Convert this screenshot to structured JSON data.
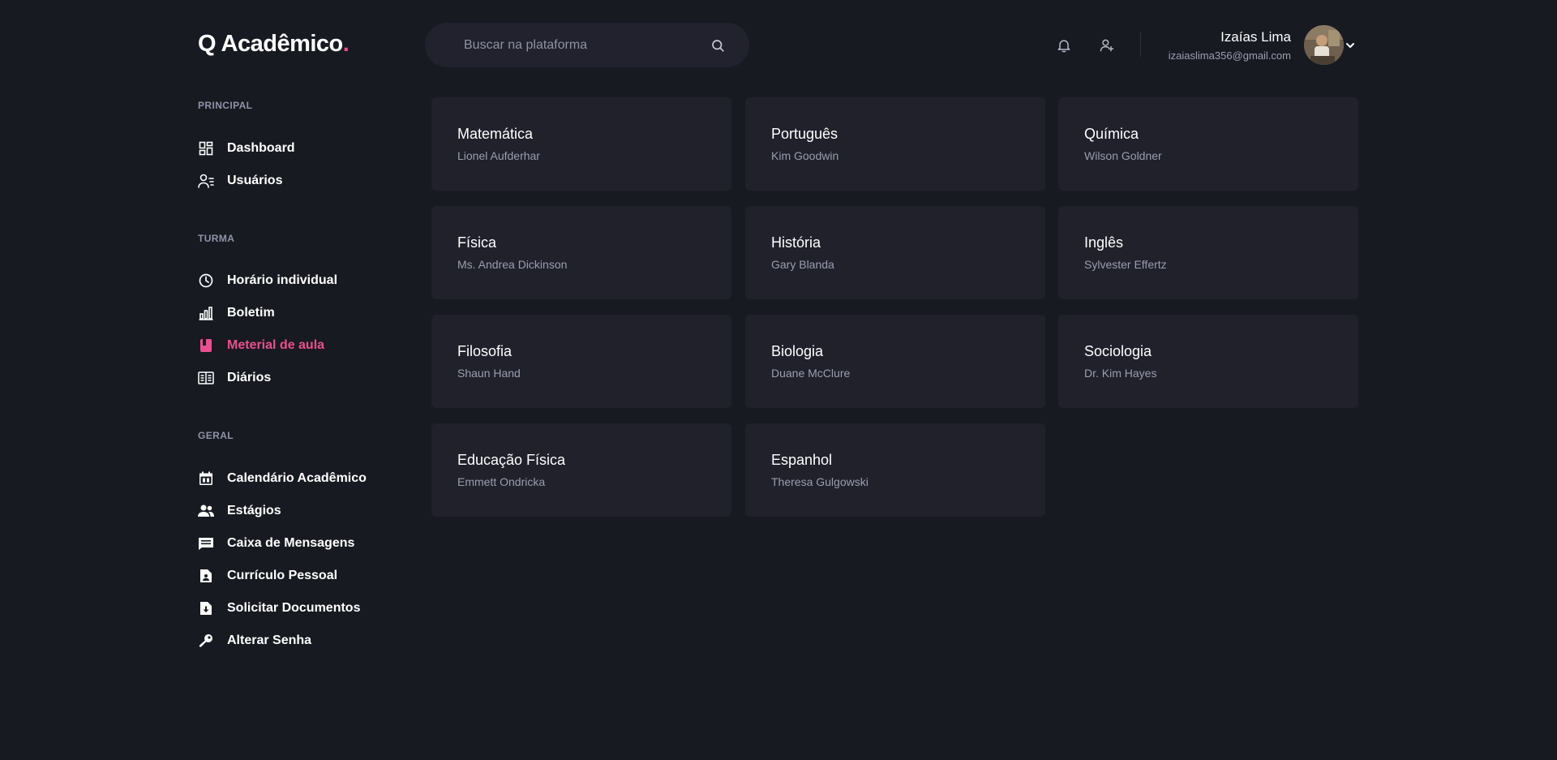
{
  "brand": {
    "name": "Q Acadêmico",
    "dot": ".",
    "accent": "#e8508f"
  },
  "search": {
    "placeholder": "Buscar na plataforma"
  },
  "header": {
    "icons": [
      "bell-icon",
      "user-add-icon"
    ],
    "user": {
      "name": "Izaías Lima",
      "email": "izaiaslima356@gmail.com"
    }
  },
  "sidebar": {
    "sections": [
      {
        "title": "PRINCIPAL",
        "items": [
          {
            "label": "Dashboard",
            "icon": "dashboard-icon"
          },
          {
            "label": "Usuários",
            "icon": "users-list-icon"
          }
        ]
      },
      {
        "title": "TURMA",
        "items": [
          {
            "label": "Horário individual",
            "icon": "clock-icon"
          },
          {
            "label": "Boletim",
            "icon": "bar-chart-icon"
          },
          {
            "label": "Meterial de aula",
            "icon": "book-icon",
            "active": true
          },
          {
            "label": "Diários",
            "icon": "journal-icon"
          }
        ]
      },
      {
        "title": "GERAL",
        "items": [
          {
            "label": "Calendário Acadêmico",
            "icon": "calendar-icon"
          },
          {
            "label": "Estágios",
            "icon": "people-icon"
          },
          {
            "label": "Caixa de Mensagens",
            "icon": "message-box-icon"
          },
          {
            "label": "Currículo Pessoal",
            "icon": "document-user-icon"
          },
          {
            "label": "Solicitar Documentos",
            "icon": "document-download-icon"
          },
          {
            "label": "Alterar Senha",
            "icon": "key-icon"
          }
        ]
      }
    ]
  },
  "subjects": [
    {
      "name": "Matemática",
      "teacher": "Lionel Aufderhar"
    },
    {
      "name": "Português",
      "teacher": "Kim Goodwin"
    },
    {
      "name": "Química",
      "teacher": "Wilson Goldner"
    },
    {
      "name": "Física",
      "teacher": "Ms. Andrea Dickinson"
    },
    {
      "name": "História",
      "teacher": "Gary Blanda"
    },
    {
      "name": "Inglês",
      "teacher": "Sylvester Effertz"
    },
    {
      "name": "Filosofia",
      "teacher": "Shaun Hand"
    },
    {
      "name": "Biologia",
      "teacher": "Duane McClure"
    },
    {
      "name": "Sociologia",
      "teacher": "Dr. Kim Hayes"
    },
    {
      "name": "Educação Física",
      "teacher": "Emmett Ondricka"
    },
    {
      "name": "Espanhol",
      "teacher": "Theresa Gulgowski"
    }
  ]
}
